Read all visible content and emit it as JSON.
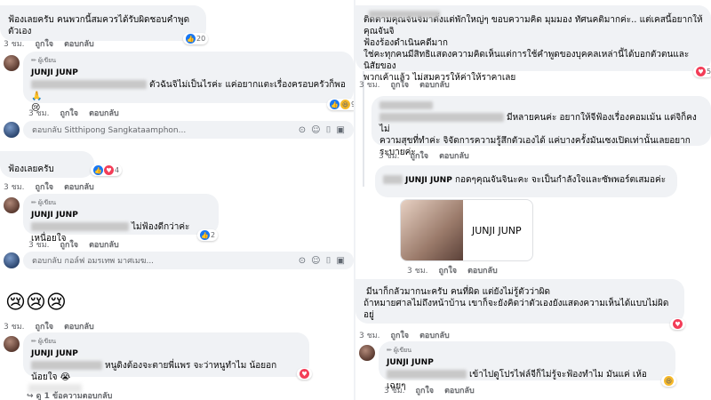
{
  "badge_label": "ผู้เขียน",
  "author_name": "JUNJI JUNP",
  "left": {
    "c1": {
      "text": "ฟ้องเลยครับ คนพวกนี้สมควรได้รับผิดชอบคำพูดตัวเอง",
      "time": "3 ชม.",
      "like": "ถูกใจ",
      "reply": "ตอบกลับ",
      "count": "20"
    },
    "c1_reply": {
      "text": "ตัวฉันจิไม่เป็นไรค่ะ แค่อยากแตะเรื่องครอบครัวก็พอ 🙏",
      "emoji": "😢",
      "time": "3 ชม.",
      "like": "ถูกใจ",
      "reply": "ตอบกลับ",
      "count": "9"
    },
    "reply_box_1": {
      "placeholder": "ตอบกลับ Sitthipong Sangkataamphon..."
    },
    "c2": {
      "text": "ฟ้องเลยครับ",
      "time": "3 ชม.",
      "like": "ถูกใจ",
      "reply": "ตอบกลับ",
      "count": "4"
    },
    "c2_reply": {
      "text": "ไม่ฟ้องดีกว่าค่ะ เหนื่อยใจ",
      "time": "3 ชม.",
      "like": "ถูกใจ",
      "reply": "ตอบกลับ",
      "count": "2"
    },
    "reply_box_2": {
      "placeholder": "ตอบกลับ กอล์ฟ อมรเทพ มาศเมฆ..."
    },
    "c3": {
      "emoji": "😢😢😢",
      "time": "3 ชม.",
      "like": "ถูกใจ",
      "reply": "ตอบกลับ"
    },
    "c3_reply": {
      "text": "หนูดิงต้องจะตายพี่แพร จะว่าหนูทำไม น้อยอกน้อยใจ 😭",
      "view_more": "↪ ดู 1 ข้อความตอบกลับ"
    }
  },
  "right": {
    "r1": {
      "line1": "ติดตามคุณจันจิมาตั้งแต่พักใหญ่ๆ ขอบความคิด มุมมอง ทัศนคติมากค่ะ.. แต่เคสนี้อยากให้คุณจันจิ",
      "line2": "ฟ้องร้องดำเนินคดีมาก",
      "line3": "ใช่คะทุกคนมีสิทธิแสดงความคิดเห็นแต่การใช้คำพูดของบุคคลเหล่านี้ได้บอกตัวตนและนิสัยของ",
      "line4": "พวกเค้าแล้ว ไม่สมควรให้ค่าให้ราคาเลย",
      "time": "3 ชม.",
      "like": "ถูกใจ",
      "reply": "ตอบกลับ",
      "count": "5"
    },
    "r2": {
      "line1": "มีหลายคนค่ะ อยากให้จีฟ้องเรื่องคอมเม้น แต่จิก็คงไม่",
      "line2": "ความสุขที่ทำค่ะ จิจัดการความรู้สึกตัวเองได้ แค่บางครั้งมันเซงเปิดเท่านั้นเลยอยากระบายค่ะ",
      "time": "3 ชม.",
      "like": "ถูกใจ",
      "reply": "ตอบกลับ"
    },
    "r2_reply": {
      "text": "กอดๆคุณจันจินะคะ จะเป็นกำลังใจและซัพพอร์ตเสมอค่ะ",
      "time": "3 ชม.",
      "like": "ถูกใจ",
      "reply": "ตอบกลับ",
      "card_name": "JUNJI JUNP"
    },
    "r3": {
      "line1": "มีนาก็กลัวมากนะครับ คนที่ผิด แต่ยังไม่รู้ตัวว่าผิด",
      "line2": "ถ้าหมายศาลไม่ถึงหน้าบ้าน เขาก็จะยังคิดว่าตัวเองยังแสดงความเห็นได้แบบไม่ผิดอยู่",
      "time": "3 ชม.",
      "like": "ถูกใจ",
      "reply": "ตอบกลับ"
    },
    "r3_reply": {
      "text": "เข้าไปดูโปรไฟล์จีก็ไม่รู้จะฟ้องทำไม มันแค่ เห้อ เฉยๆ",
      "time": "3 ชม.",
      "like": "ถูกใจ",
      "reply": "ตอบกลับ"
    }
  },
  "colors": {
    "bubble": "#f0f2f5",
    "meta": "#65676b",
    "like_blue": "#1877f2",
    "heart_red": "#f33e58"
  }
}
